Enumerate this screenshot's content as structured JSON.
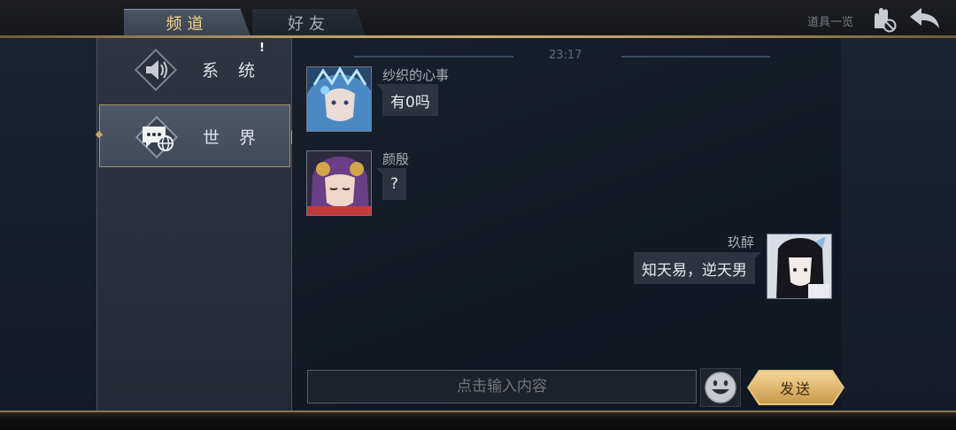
{
  "tabs": [
    {
      "label": "频道",
      "active": true
    },
    {
      "label": "好友",
      "active": false
    }
  ],
  "top_right": {
    "items_list_label": "道具一览"
  },
  "sidebar": {
    "items": [
      {
        "label": "系 统",
        "badge": "!"
      },
      {
        "label": "世 界",
        "selected": true
      }
    ]
  },
  "chat": {
    "timestamp": "23:17",
    "messages": [
      {
        "sender": "纱织的心事",
        "text": "有0吗",
        "side": "left"
      },
      {
        "sender": "颜殷",
        "text": "?",
        "side": "left"
      },
      {
        "sender": "玖醉",
        "text": "知天易，逆天男",
        "side": "right"
      }
    ]
  },
  "input": {
    "placeholder": "点击输入内容",
    "send_label": "发送"
  },
  "colors": {
    "accent_gold": "#c9a96a",
    "tab_active_text": "#f0d48a",
    "bubble_bg": "#2d3440"
  }
}
